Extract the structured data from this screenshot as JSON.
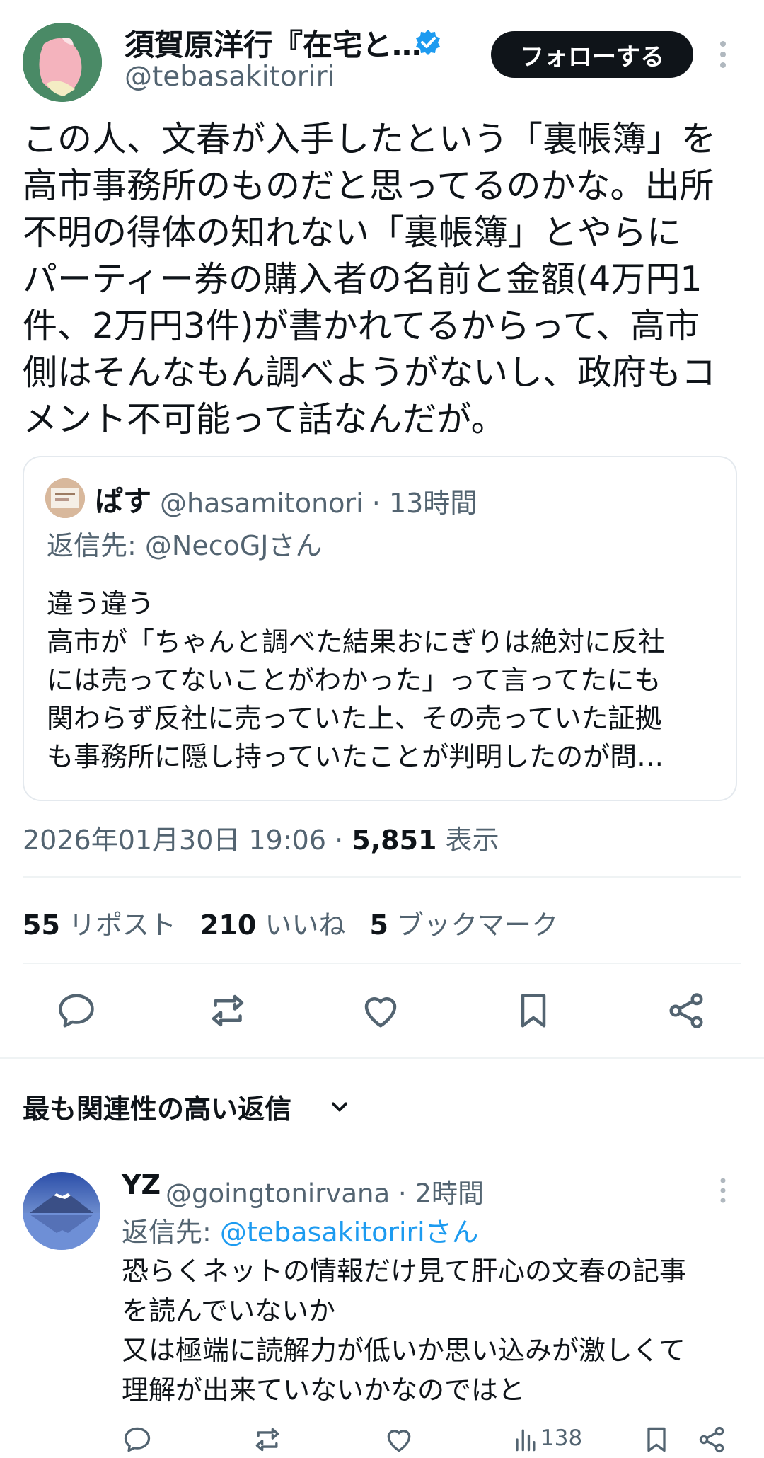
{
  "tweet": {
    "author_name": "須賀原洋行『在宅と…",
    "author_handle": "@tebasakitoriri",
    "follow_label": "フォローする",
    "body_lines": [
      "この人、文春が入手したという「裏帳簿」を",
      "高市事務所のものだと思ってるのかな。出所",
      "不明の得体の知れない「裏帳簿」とやらに",
      "パーティー券の購入者の名前と金額(4万円1",
      "件、2万円3件)が書かれてるからって、高市",
      "側はそんなもん調べようがないし、政府もコ",
      "メント不可能って話なんだが。"
    ],
    "timestamp": "2026年01月30日 19:06",
    "views_count": "5,851",
    "views_label": "表示",
    "reposts_count": "55",
    "reposts_label": "リポスト",
    "likes_count": "210",
    "likes_label": "いいね",
    "bookmarks_count": "5",
    "bookmarks_label": "ブックマーク"
  },
  "quote": {
    "name": "ぱす",
    "handle": "@hasamitonori",
    "time": "13時間",
    "reply_prefix": "返信先: ",
    "reply_to": "@NecoGJさん",
    "text_lines": [
      "違う違う",
      "高市が「ちゃんと調べた結果おにぎりは絶対に反社",
      "には売ってないことがわかった」って言ってたにも",
      "関わらず反社に売っていた上、その売っていた証拠",
      "も事務所に隠し持っていたことが判明したのが問…"
    ]
  },
  "replies_sort_label": "最も関連性の高い返信",
  "reply": {
    "name": "YZ",
    "handle": "@goingtonirvana",
    "time": "2時間",
    "reply_prefix": "返信先: ",
    "reply_to": "@tebasakitoririさん",
    "text_lines": [
      "恐らくネットの情報だけ見て肝心の文春の記事",
      "を読んでいないか",
      "又は極端に読解力が低いか思い込みが激しくて",
      "理解が出来ていないかなのではと"
    ],
    "views": "138"
  },
  "icons": {
    "verified": "verified-badge-icon",
    "more": "more-options-icon",
    "reply": "reply-icon",
    "repost": "repost-icon",
    "like": "like-icon",
    "bookmark": "bookmark-icon",
    "share": "share-icon",
    "chevron": "chevron-down-icon",
    "views": "views-icon"
  },
  "colors": {
    "accent": "#1d9bf0",
    "text": "#0f1419",
    "muted": "#536471",
    "button": "#0f1419"
  }
}
